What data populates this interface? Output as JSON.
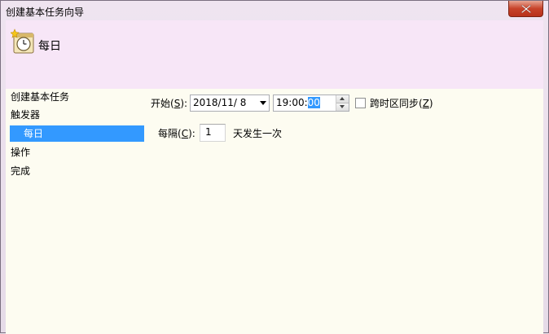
{
  "window": {
    "title": "创建基本任务向导",
    "close_icon": "close-icon"
  },
  "header": {
    "icon": "calendar-clock-icon",
    "title": "每日"
  },
  "nav": {
    "items": [
      {
        "label": "创建基本任务",
        "selected": false
      },
      {
        "label": "触发器",
        "selected": false
      },
      {
        "label": "每日",
        "selected": true
      },
      {
        "label": "操作",
        "selected": false
      },
      {
        "label": "完成",
        "selected": false
      }
    ]
  },
  "start": {
    "label_prefix": "开始(",
    "label_key": "S",
    "label_suffix": "):",
    "date": "2018/11/  8",
    "time_prefix": "19:00:",
    "time_selected": "00"
  },
  "sync_timezone": {
    "label_prefix": "跨时区同步(",
    "label_key": "Z",
    "label_suffix": ")",
    "checked": false
  },
  "recur": {
    "label_prefix": "每隔(",
    "label_key": "C",
    "label_suffix": "):",
    "value": "1",
    "unit": "天发生一次"
  },
  "colors": {
    "selection": "#3399ff",
    "content_bg": "#fdfcf1",
    "header_bg": "#f7e6f7"
  }
}
